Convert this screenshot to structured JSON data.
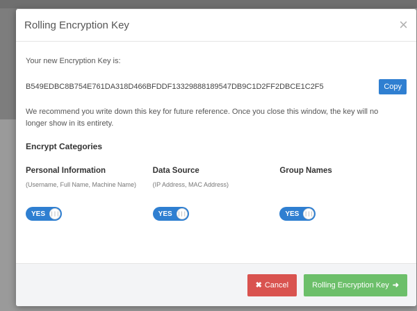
{
  "modal": {
    "title": "Rolling Encryption Key",
    "close_symbol": "×",
    "intro": "Your new Encryption Key is:",
    "key": "B549EDBC8B754E761DA318D466BFDDF13329888189547DB9C1D2FF2DBCE1C2F5",
    "copy_label": "Copy",
    "recommend": "We recommend you write down this key for future reference. Once you close this window, the key will no longer show in its entirety.",
    "section_title": "Encrypt Categories",
    "categories": [
      {
        "name": "Personal Information",
        "desc": "(Username, Full Name, Machine Name)",
        "toggle": "YES",
        "enabled": true
      },
      {
        "name": "Data Source",
        "desc": "(IP Address, MAC Address)",
        "toggle": "YES",
        "enabled": true
      },
      {
        "name": "Group Names",
        "desc": "",
        "toggle": "YES",
        "enabled": true
      }
    ],
    "cancel_label": "Cancel",
    "cancel_icon": "✖",
    "roll_label": "Rolling Encryption Key",
    "roll_icon": "➜"
  },
  "colors": {
    "primary": "#2f7fd1",
    "danger": "#d9534f",
    "success": "#6cbf6a"
  },
  "icons": [
    "close-icon",
    "cancel-x-icon",
    "arrow-right-icon",
    "toggle-knob-icon"
  ]
}
